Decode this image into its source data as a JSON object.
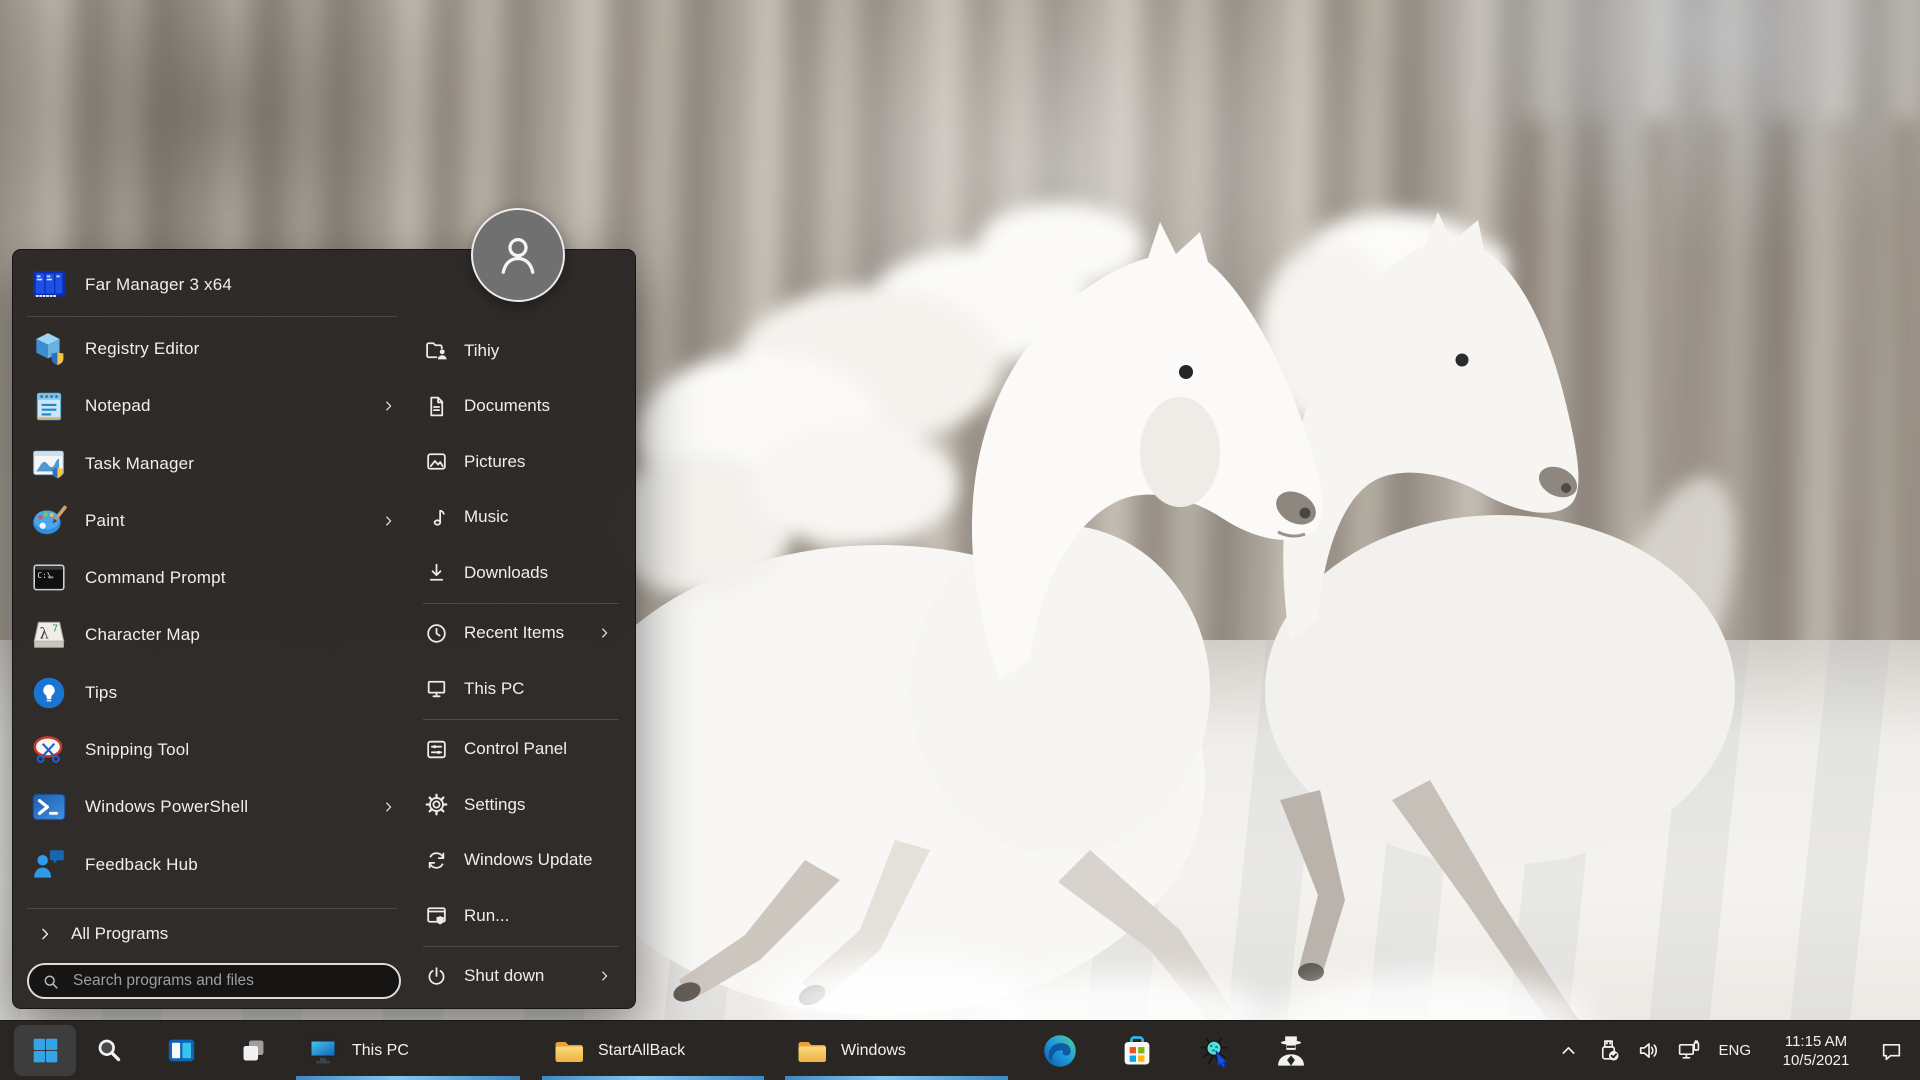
{
  "wallpaper": {
    "description": "Two white horses galloping through snow in front of a blurred winter forest"
  },
  "start_menu": {
    "user_name": "Tihiy",
    "left_items": [
      {
        "label": "Far Manager 3 x64",
        "icon": "far-manager-icon",
        "submenu": false,
        "separator_after": true
      },
      {
        "label": "Registry Editor",
        "icon": "registry-editor-icon"
      },
      {
        "label": "Notepad",
        "icon": "notepad-icon",
        "submenu": true
      },
      {
        "label": "Task Manager",
        "icon": "task-manager-icon"
      },
      {
        "label": "Paint",
        "icon": "paint-icon",
        "submenu": true
      },
      {
        "label": "Command Prompt",
        "icon": "command-prompt-icon"
      },
      {
        "label": "Character Map",
        "icon": "character-map-icon"
      },
      {
        "label": "Tips",
        "icon": "tips-icon"
      },
      {
        "label": "Snipping Tool",
        "icon": "snipping-tool-icon"
      },
      {
        "label": "Windows PowerShell",
        "icon": "powershell-icon",
        "submenu": true
      },
      {
        "label": "Feedback Hub",
        "icon": "feedback-hub-icon"
      }
    ],
    "all_programs_label": "All Programs",
    "search_placeholder": "Search programs and files",
    "right_items": [
      {
        "label": "Tihiy",
        "icon": "user-folder-icon"
      },
      {
        "label": "Documents",
        "icon": "document-icon"
      },
      {
        "label": "Pictures",
        "icon": "pictures-icon"
      },
      {
        "label": "Music",
        "icon": "music-note-icon"
      },
      {
        "label": "Downloads",
        "icon": "download-icon",
        "separator_after": true
      },
      {
        "label": "Recent Items",
        "icon": "clock-icon",
        "submenu": true
      },
      {
        "label": "This PC",
        "icon": "monitor-outline-icon",
        "separator_after": true
      },
      {
        "label": "Control Panel",
        "icon": "control-panel-icon"
      },
      {
        "label": "Settings",
        "icon": "gear-icon"
      },
      {
        "label": "Windows Update",
        "icon": "sync-icon"
      },
      {
        "label": "Run...",
        "icon": "run-shield-icon",
        "separator_after": true
      },
      {
        "label": "Shut down",
        "icon": "power-icon",
        "submenu": true
      }
    ]
  },
  "taskbar": {
    "start_button": {
      "icon": "windows-logo-icon"
    },
    "quick_icons": [
      {
        "icon": "search-icon"
      },
      {
        "icon": "task-view-icon"
      },
      {
        "icon": "stacked-windows-icon"
      }
    ],
    "app_buttons": [
      {
        "label": "This PC",
        "icon": "pc-monitor-icon"
      },
      {
        "label": "StartAllBack",
        "icon": "folder-icon"
      },
      {
        "label": "Windows",
        "icon": "folder-icon"
      }
    ],
    "pinned_icons": [
      {
        "icon": "edge-icon"
      },
      {
        "icon": "microsoft-store-icon"
      },
      {
        "icon": "spider-scanner-icon"
      },
      {
        "icon": "agent-icon"
      }
    ],
    "tray": {
      "overflow_icon": "chevron-up-icon",
      "status_icons": [
        {
          "icon": "usb-eject-icon"
        },
        {
          "icon": "volume-icon"
        },
        {
          "icon": "network-display-icon"
        }
      ],
      "language": "ENG",
      "time": "11:15 AM",
      "date": "10/5/2021",
      "notification_icon": "chat-bubble-icon"
    }
  },
  "colors": {
    "taskbar_bg": "#292624",
    "menu_bg": "#2c2927",
    "accent_underline": "#5fb2e8",
    "windows_blue": "#35a3e8"
  }
}
